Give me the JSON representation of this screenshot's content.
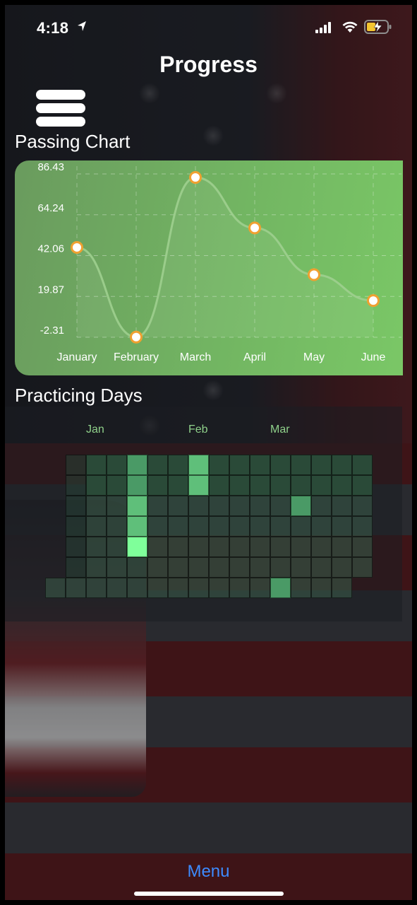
{
  "status_bar": {
    "time": "4:18"
  },
  "header": {
    "title": "Progress"
  },
  "passing_chart": {
    "title": "Passing Chart"
  },
  "chart_data": {
    "type": "line",
    "title": "",
    "categories": [
      "January",
      "February",
      "March",
      "April",
      "May",
      "June"
    ],
    "values": [
      46.5,
      -2.2,
      84.5,
      57.1,
      31.7,
      17.6
    ],
    "y_ticks": [
      "86.43",
      "64.24",
      "42.06",
      "19.87",
      "-2.31"
    ],
    "ylim": [
      -2.31,
      86.43
    ],
    "grid": true,
    "colors": {
      "line": "#9fcf8f",
      "point_fill": "#ffffff",
      "point_stroke": "#f0a030",
      "background": "#74b563"
    }
  },
  "practicing_days": {
    "title": "Practicing Days",
    "months": [
      "Jan",
      "Feb",
      "Mar"
    ],
    "grid": [
      [
        0,
        1,
        1,
        2,
        1,
        1,
        3,
        1,
        1,
        1,
        1,
        1,
        1,
        1,
        1
      ],
      [
        0,
        1,
        1,
        2,
        1,
        1,
        3,
        1,
        1,
        1,
        1,
        1,
        1,
        1,
        1
      ],
      [
        0,
        1,
        1,
        3,
        1,
        1,
        1,
        1,
        1,
        1,
        1,
        2,
        1,
        1,
        1
      ],
      [
        0,
        1,
        1,
        3,
        1,
        1,
        1,
        1,
        1,
        1,
        1,
        1,
        1,
        1,
        1
      ],
      [
        0,
        1,
        1,
        4,
        1,
        1,
        1,
        1,
        1,
        1,
        1,
        1,
        1,
        1,
        1
      ],
      [
        0,
        1,
        1,
        1,
        1,
        1,
        1,
        1,
        1,
        1,
        1,
        1,
        1,
        1,
        1
      ],
      [
        1,
        1,
        1,
        1,
        1,
        1,
        1,
        1,
        1,
        1,
        1,
        2,
        1,
        1,
        0
      ]
    ],
    "colors": [
      "#1e3a2a",
      "#2a4a38",
      "#4a9a66",
      "#5fbf7a",
      "#7fff9a"
    ]
  },
  "footer": {
    "menu_label": "Menu"
  }
}
